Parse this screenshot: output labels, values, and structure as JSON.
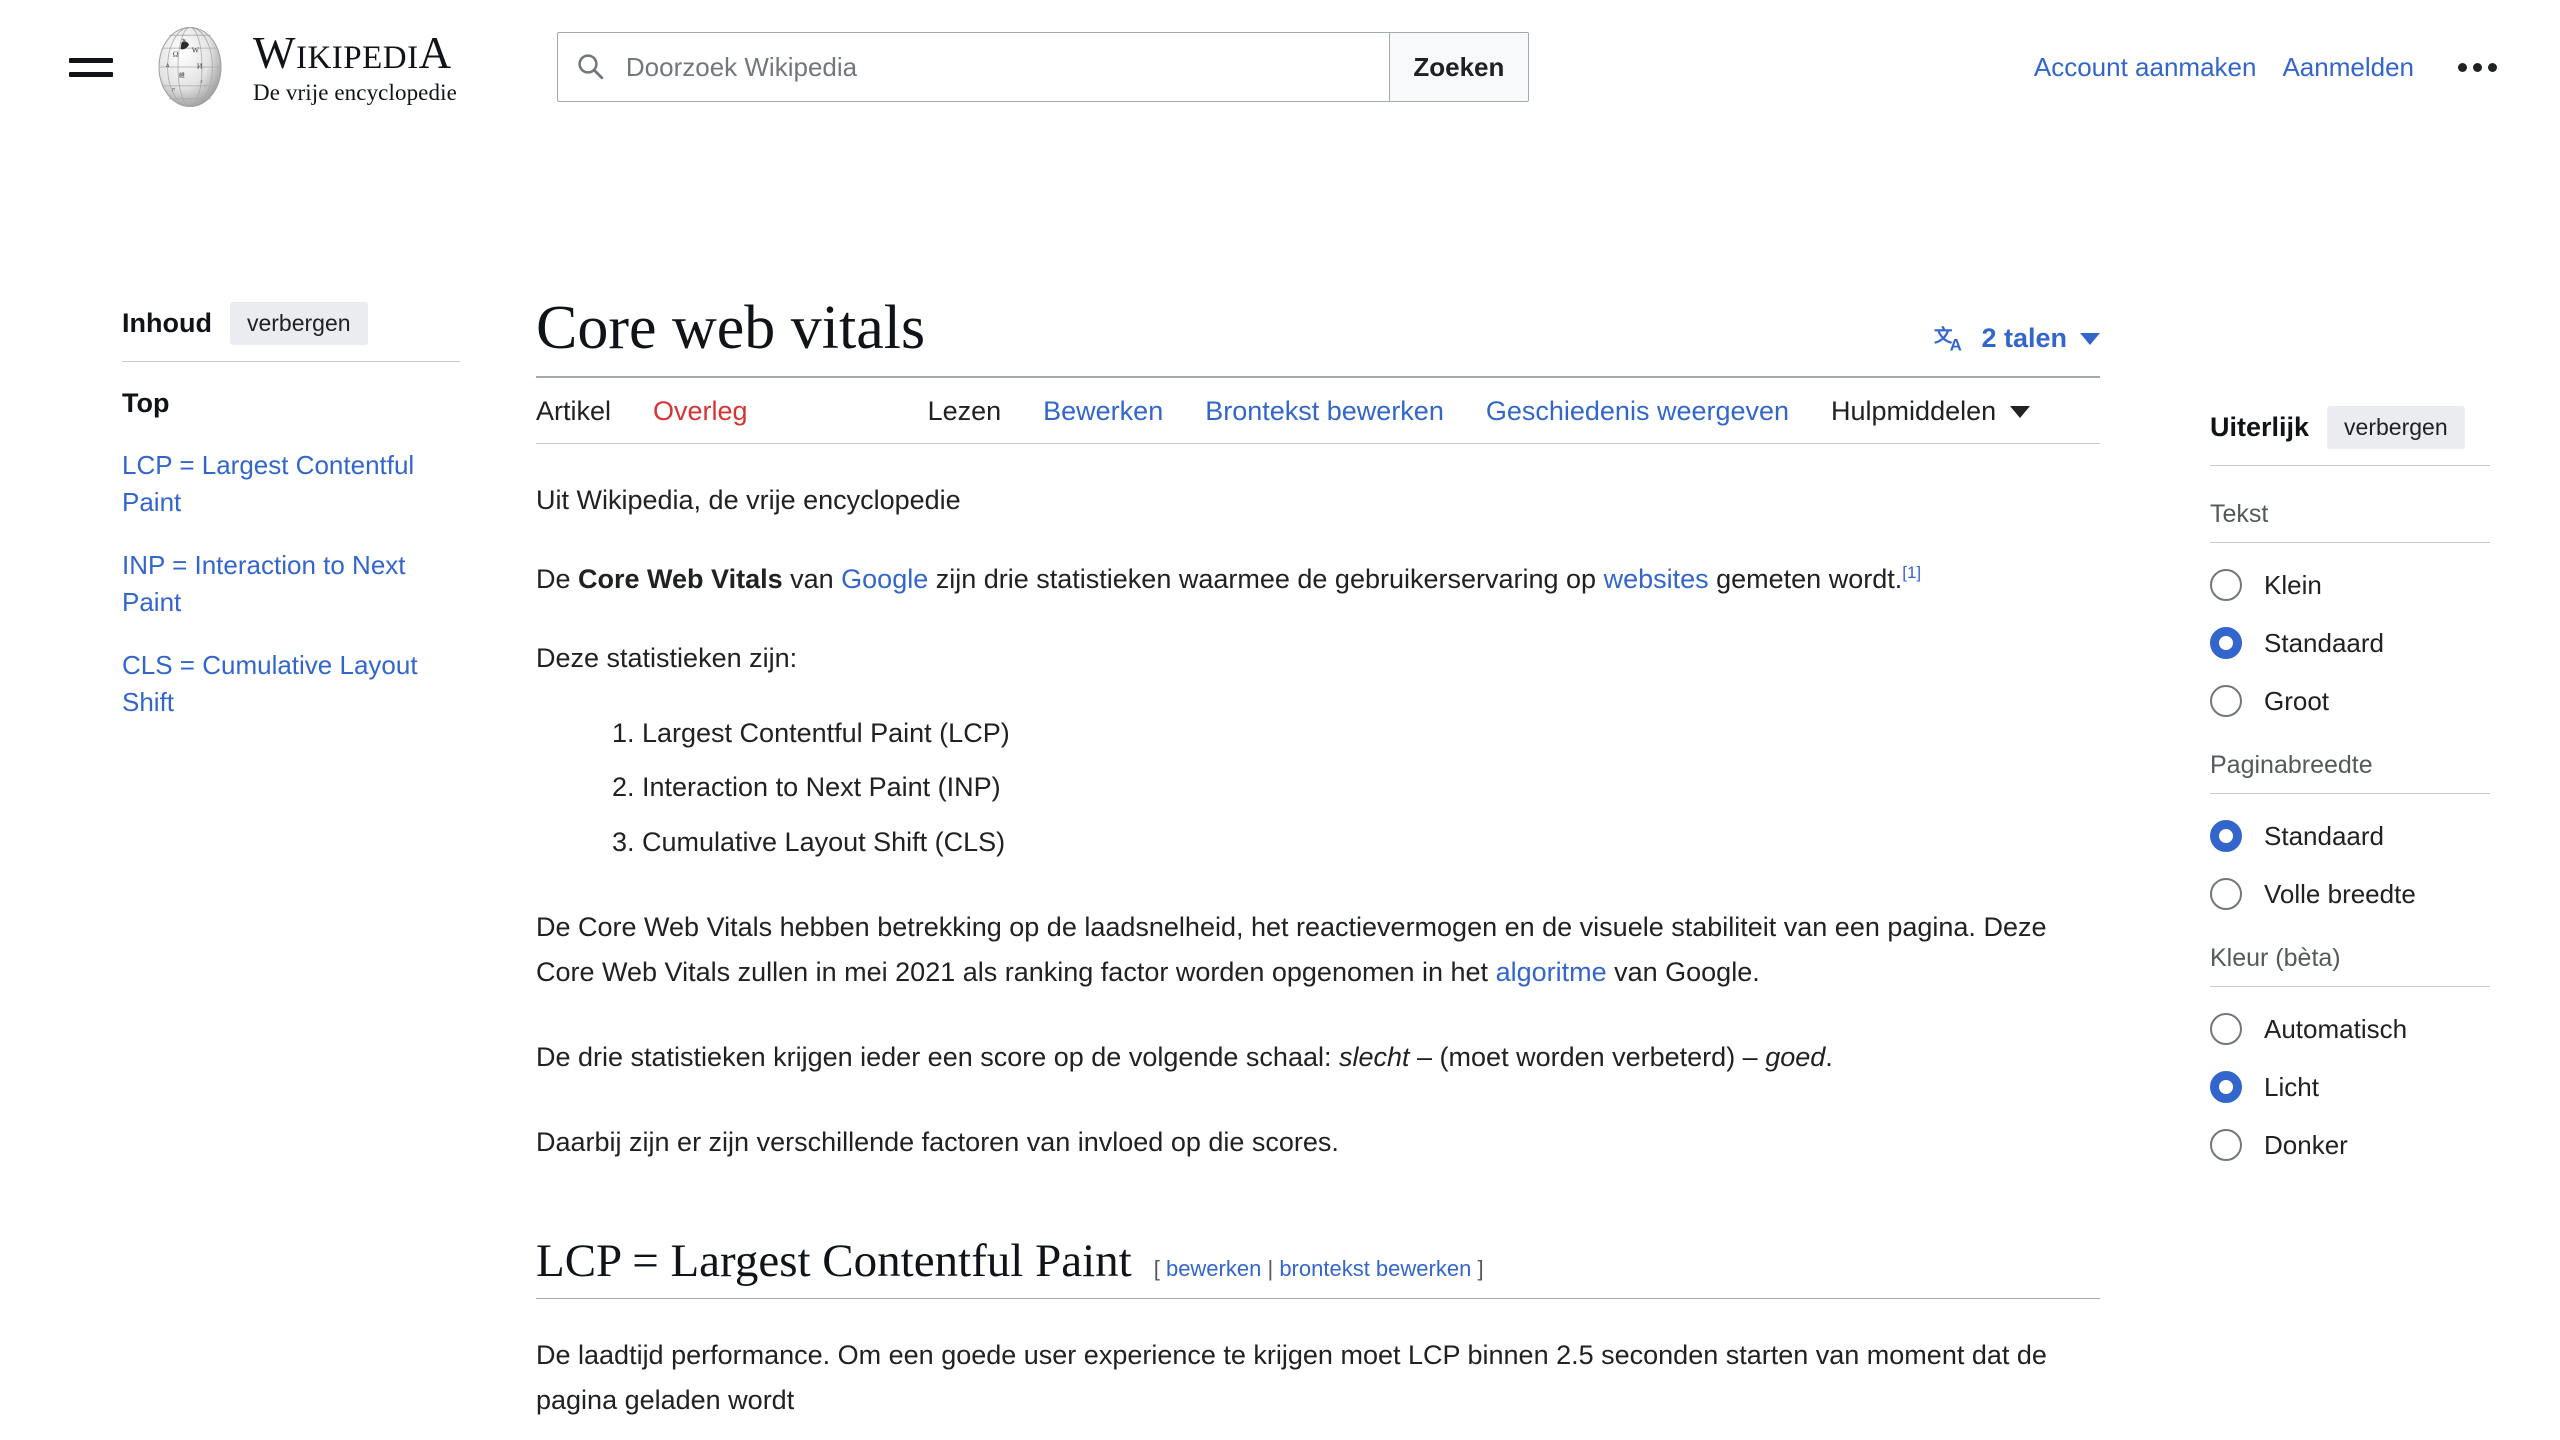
{
  "header": {
    "hamburger_icon": "menu-icon",
    "logo_icon": "wikipedia-globe-icon",
    "wordmark_first": "W",
    "wordmark_rest_1": "IKIPEDI",
    "wordmark_last": "A",
    "tagline": "De vrije encyclopedie",
    "search": {
      "icon": "search-icon",
      "placeholder": "Doorzoek Wikipedia",
      "value": "",
      "button_label": "Zoeken"
    },
    "account_links": [
      {
        "label": "Account aanmaken"
      },
      {
        "label": "Aanmelden"
      }
    ],
    "more_icon": "ellipsis-icon"
  },
  "toc": {
    "heading": "Inhoud",
    "hide_label": "verbergen",
    "top_label": "Top",
    "items": [
      {
        "label": "LCP = Largest Contentful Paint"
      },
      {
        "label": "INP = Interaction to Next Paint"
      },
      {
        "label": "CLS = Cumulative Layout Shift"
      }
    ]
  },
  "article": {
    "title": "Core web vitals",
    "languages": {
      "icon": "language-translate-icon",
      "label": "2 talen",
      "chevron_icon": "chevron-down-icon"
    },
    "namespace_tabs": [
      {
        "label": "Artikel",
        "state": "selected"
      },
      {
        "label": "Overleg",
        "state": "new-page"
      }
    ],
    "view_tabs": [
      {
        "label": "Lezen",
        "state": "selected"
      },
      {
        "label": "Bewerken",
        "state": "link"
      },
      {
        "label": "Brontekst bewerken",
        "state": "link"
      },
      {
        "label": "Geschiedenis weergeven",
        "state": "link"
      }
    ],
    "tools_menu": {
      "label": "Hulpmiddelen",
      "chevron_icon": "chevron-down-icon"
    },
    "siteSub": "Uit Wikipedia, de vrije encyclopedie",
    "lead": {
      "t1": "De ",
      "bold": "Core Web Vitals",
      "t2": " van ",
      "link_google": "Google",
      "t3": " zijn drie statistieken waarmee de gebruikerservaring op ",
      "link_websites": "websites",
      "t4": " gemeten wordt.",
      "ref": "[1]"
    },
    "intro_list_lead": "Deze statistieken zijn:",
    "stats_list": [
      "Largest Contentful Paint (LCP)",
      "Interaction to Next Paint (INP)",
      "Cumulative Layout Shift (CLS)"
    ],
    "para_ranking": {
      "t1": "De Core Web Vitals hebben betrekking op de laadsnelheid, het reactievermogen en de visuele stabiliteit van een pagina. Deze Core Web Vitals zullen in mei 2021 als ranking factor worden opgenomen in het ",
      "link_algoritme": "algoritme",
      "t2": " van Google."
    },
    "para_scale": {
      "t1": "De drie statistieken krijgen ieder een score op de volgende schaal: ",
      "i1": "slecht",
      "t2": " – (moet worden verbeterd) – ",
      "i2": "goed",
      "t3": "."
    },
    "para_factors": "Daarbij zijn er zijn verschillende factoren van invloed op die scores.",
    "section_lcp": {
      "heading": "LCP = Largest Contentful Paint",
      "edit_open": "[",
      "edit_label": "bewerken",
      "edit_pipe": "|",
      "editsource_label": "brontekst bewerken",
      "edit_close": "]",
      "body": "De laadtijd performance. Om een goede user experience te krijgen moet LCP binnen 2.5 seconden starten van moment dat de pagina geladen wordt"
    }
  },
  "appearance": {
    "heading": "Uiterlijk",
    "hide_label": "verbergen",
    "groups": [
      {
        "label": "Tekst",
        "options": [
          {
            "label": "Klein",
            "selected": false
          },
          {
            "label": "Standaard",
            "selected": true
          },
          {
            "label": "Groot",
            "selected": false
          }
        ]
      },
      {
        "label": "Paginabreedte",
        "options": [
          {
            "label": "Standaard",
            "selected": true
          },
          {
            "label": "Volle breedte",
            "selected": false
          }
        ]
      },
      {
        "label": "Kleur (bèta)",
        "options": [
          {
            "label": "Automatisch",
            "selected": false
          },
          {
            "label": "Licht",
            "selected": true
          },
          {
            "label": "Donker",
            "selected": false
          }
        ]
      }
    ]
  },
  "colors": {
    "link": "#3366cc",
    "new_page_link": "#d73333",
    "text": "#202122",
    "muted": "#54595d",
    "accent_radio": "#3366cc",
    "rule": "#a2a9b1",
    "button_bg": "#eaecf0"
  }
}
